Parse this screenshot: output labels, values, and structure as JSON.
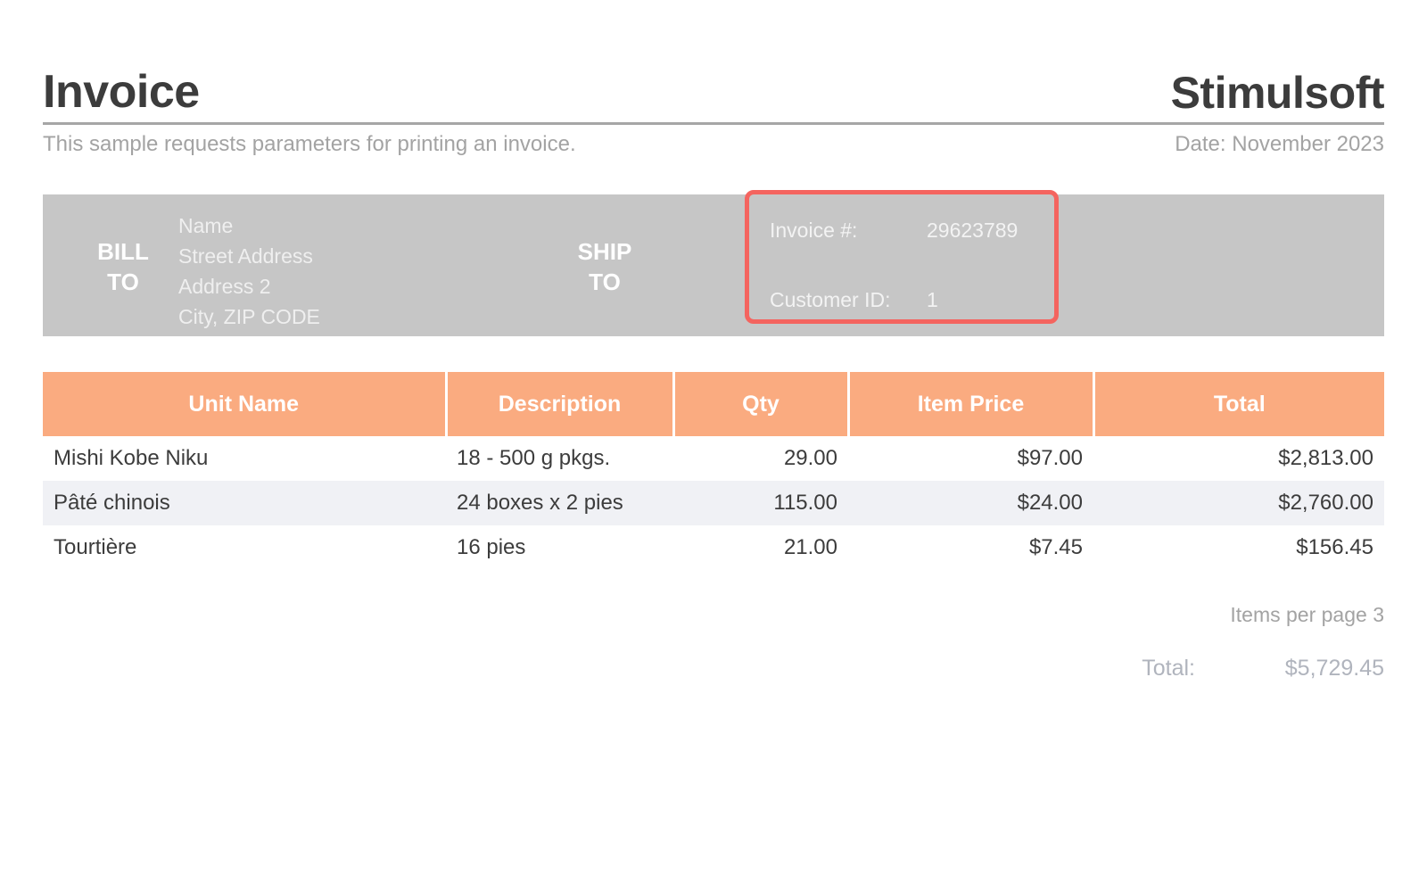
{
  "header": {
    "title": "Invoice",
    "brand": "Stimulsoft",
    "subtitle": "This sample requests parameters for printing an invoice.",
    "date": "Date: November 2023"
  },
  "address": {
    "bill_to_line1": "BILL",
    "bill_to_line2": "TO",
    "ship_to_line1": "SHIP",
    "ship_to_line2": "TO",
    "lines": [
      "Name",
      "Street Address",
      "Address 2",
      "City,  ZIP CODE"
    ]
  },
  "meta": {
    "invoice_number_label": "Invoice #:",
    "invoice_number_value": "29623789",
    "customer_id_label": "Customer ID:",
    "customer_id_value": "1",
    "highlight_color": "#f4645f"
  },
  "table": {
    "columns": [
      "Unit Name",
      "Description",
      "Qty",
      "Item Price",
      "Total"
    ],
    "rows": [
      {
        "unit_name": "Mishi Kobe Niku",
        "description": "18 - 500 g pkgs.",
        "qty": "29.00",
        "item_price": "$97.00",
        "total": "$2,813.00"
      },
      {
        "unit_name": "Pâté chinois",
        "description": "24 boxes x 2 pies",
        "qty": "115.00",
        "item_price": "$24.00",
        "total": "$2,760.00"
      },
      {
        "unit_name": "Tourtière",
        "description": "16 pies",
        "qty": "21.00",
        "item_price": "$7.45",
        "total": "$156.45"
      }
    ],
    "header_color": "#faab80",
    "alt_row_color": "#f0f1f5"
  },
  "footer": {
    "items_per_page": "Items per page 3",
    "total_label": "Total:",
    "total_value": "$5,729.45"
  }
}
